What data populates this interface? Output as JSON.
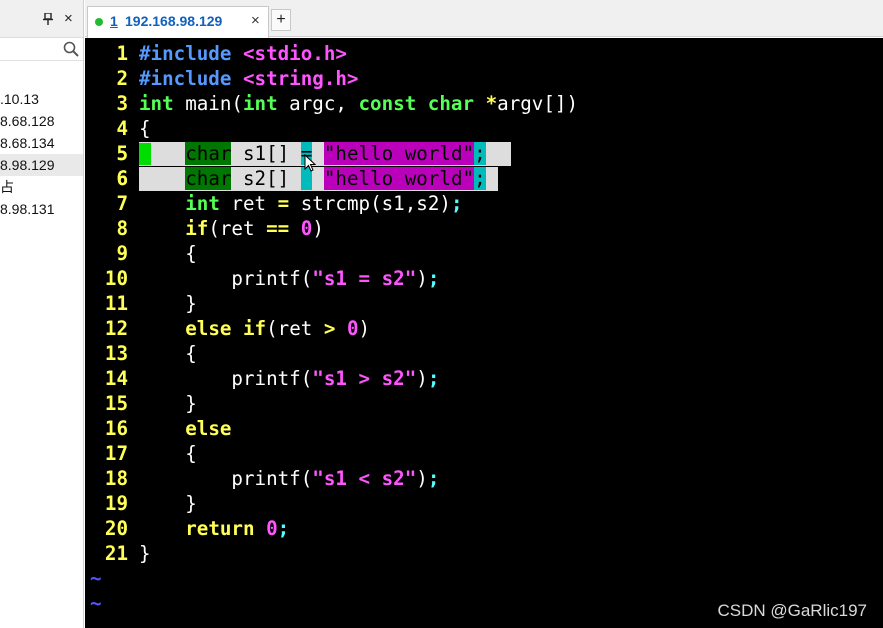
{
  "left_panel": {
    "close_glyph": "×",
    "sessions": [
      ".10.13",
      "8.68.128",
      "8.68.134",
      "8.98.129",
      "占",
      "8.98.131"
    ],
    "selected_index": 3
  },
  "tabs": [
    {
      "number": "1",
      "title": "192.168.98.129",
      "close_glyph": "×",
      "status_color": "#22bb33"
    }
  ],
  "add_tab_label": "+",
  "editor": {
    "lines": [
      {
        "n": "1",
        "tokens": [
          [
            "pp",
            "#include "
          ],
          [
            "inc",
            "<stdio.h>"
          ]
        ]
      },
      {
        "n": "2",
        "tokens": [
          [
            "pp",
            "#include "
          ],
          [
            "inc",
            "<string.h>"
          ]
        ]
      },
      {
        "n": "3",
        "tokens": [
          [
            "ty",
            "int"
          ],
          [
            "plain",
            " main("
          ],
          [
            "ty",
            "int"
          ],
          [
            "plain",
            " argc, "
          ],
          [
            "ty",
            "const char"
          ],
          [
            "plain",
            " "
          ],
          [
            "op",
            "*"
          ],
          [
            "plain",
            "argv[])"
          ]
        ]
      },
      {
        "n": "4",
        "tokens": [
          [
            "plain",
            "{"
          ]
        ]
      },
      {
        "n": "5",
        "tokens": []
      },
      {
        "n": "6",
        "tokens": []
      },
      {
        "n": "7",
        "tokens": [
          [
            "plain",
            "    "
          ],
          [
            "ty",
            "int"
          ],
          [
            "plain",
            " ret "
          ],
          [
            "op",
            "="
          ],
          [
            "plain",
            " strcmp(s1,s2)"
          ],
          [
            "pu",
            ";"
          ]
        ]
      },
      {
        "n": "8",
        "tokens": [
          [
            "plain",
            "    "
          ],
          [
            "kw",
            "if"
          ],
          [
            "plain",
            "(ret "
          ],
          [
            "op",
            "=="
          ],
          [
            "plain",
            " "
          ],
          [
            "num",
            "0"
          ],
          [
            "plain",
            ")"
          ]
        ]
      },
      {
        "n": "9",
        "tokens": [
          [
            "plain",
            "    {"
          ]
        ]
      },
      {
        "n": "10",
        "tokens": [
          [
            "plain",
            "        printf("
          ],
          [
            "str",
            "\"s1 = s2\""
          ],
          [
            "plain",
            ")"
          ],
          [
            "pu",
            ";"
          ]
        ]
      },
      {
        "n": "11",
        "tokens": [
          [
            "plain",
            "    }"
          ]
        ]
      },
      {
        "n": "12",
        "tokens": [
          [
            "plain",
            "    "
          ],
          [
            "kw",
            "else if"
          ],
          [
            "plain",
            "(ret "
          ],
          [
            "op",
            ">"
          ],
          [
            "plain",
            " "
          ],
          [
            "num",
            "0"
          ],
          [
            "plain",
            ")"
          ]
        ]
      },
      {
        "n": "13",
        "tokens": [
          [
            "plain",
            "    {"
          ]
        ]
      },
      {
        "n": "14",
        "tokens": [
          [
            "plain",
            "        printf("
          ],
          [
            "str",
            "\"s1 > s2\""
          ],
          [
            "plain",
            ")"
          ],
          [
            "pu",
            ";"
          ]
        ]
      },
      {
        "n": "15",
        "tokens": [
          [
            "plain",
            "    }"
          ]
        ]
      },
      {
        "n": "16",
        "tokens": [
          [
            "plain",
            "    "
          ],
          [
            "kw",
            "else"
          ]
        ]
      },
      {
        "n": "17",
        "tokens": [
          [
            "plain",
            "    {"
          ]
        ]
      },
      {
        "n": "18",
        "tokens": [
          [
            "plain",
            "        printf("
          ],
          [
            "str",
            "\"s1 < s2\""
          ],
          [
            "plain",
            ")"
          ],
          [
            "pu",
            ";"
          ]
        ]
      },
      {
        "n": "19",
        "tokens": [
          [
            "plain",
            "    }"
          ]
        ]
      },
      {
        "n": "20",
        "tokens": [
          [
            "plain",
            "    "
          ],
          [
            "kw",
            "return"
          ],
          [
            "plain",
            " "
          ],
          [
            "num",
            "0"
          ],
          [
            "pu",
            ";"
          ]
        ]
      },
      {
        "n": "21",
        "tokens": [
          [
            "plain",
            "}"
          ]
        ]
      }
    ],
    "selected_lines": [
      {
        "n": "5",
        "type": "char",
        "name": " s1[] ",
        "eq": "=",
        "str": "\"hello world\"",
        "semi": ";"
      },
      {
        "n": "6",
        "type": "char",
        "name": " s2[] ",
        "eq": " ",
        "str": "\"hello world\"",
        "semi": ";"
      }
    ],
    "tilde": "~",
    "tilde_count": 2
  },
  "watermark": "CSDN @GaRlic197",
  "colors": {
    "terminal_bg": "#000000",
    "line_number": "#ffff55",
    "selection": "#dddddd"
  }
}
